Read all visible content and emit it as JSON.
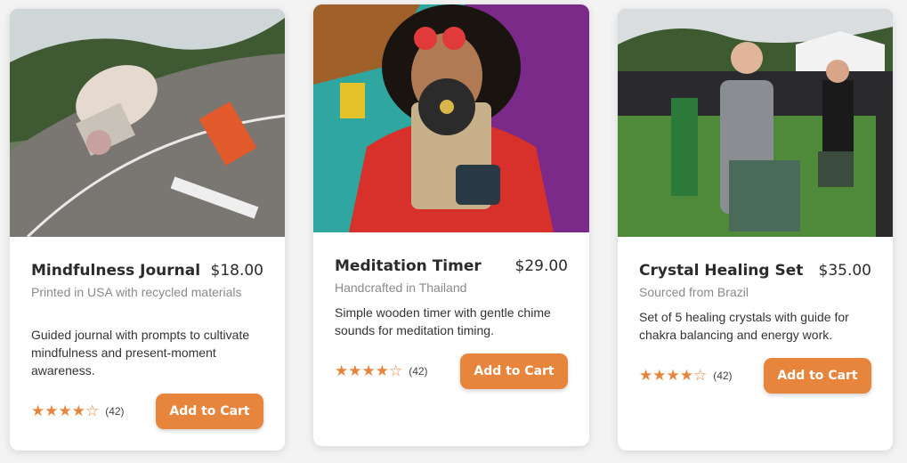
{
  "products": [
    {
      "title": "Mindfulness Journal",
      "price": "$18.00",
      "origin": "Printed in USA with recycled materials",
      "description": "Guided journal with prompts to cultivate mindfulness and present-moment awareness.",
      "stars": "★★★★☆",
      "rating_count": "(42)",
      "cart_label": "Add to Cart"
    },
    {
      "title": "Meditation Timer",
      "price": "$29.00",
      "origin": "Handcrafted in Thailand",
      "description": "Simple wooden timer with gentle chime sounds for meditation timing.",
      "stars": "★★★★☆",
      "rating_count": "(42)",
      "cart_label": "Add to Cart"
    },
    {
      "title": "Crystal Healing Set",
      "price": "$35.00",
      "origin": "Sourced from Brazil",
      "description": "Set of 5 healing crystals with guide for chakra balancing and energy work.",
      "stars": "★★★★☆",
      "rating_count": "(42)",
      "cart_label": "Add to Cart"
    }
  ],
  "rating_value": 4.5,
  "colors": {
    "accent": "#e8853d",
    "text": "#2b2b2b",
    "muted": "#8a8a8a"
  }
}
